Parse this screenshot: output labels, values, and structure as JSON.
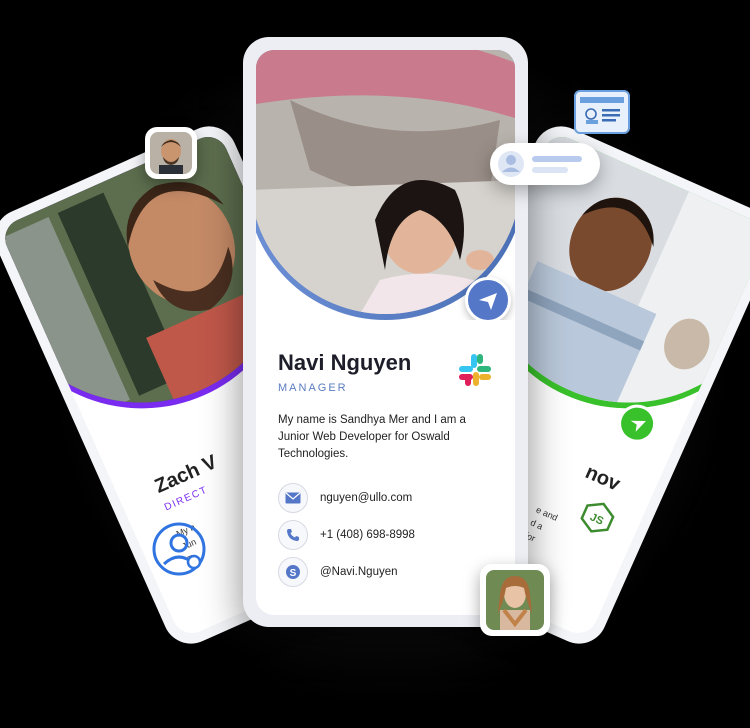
{
  "main_card": {
    "name": "Navi Nguyen",
    "role": "MANAGER",
    "bio": "My name is Sandhya Mer and I am a Junior Web Developer for Oswald Technologies.",
    "contacts": [
      {
        "type": "email",
        "icon": "envelope-icon",
        "value": "nguyen@ullo.com"
      },
      {
        "type": "phone",
        "icon": "phone-icon",
        "value": "+1 (408) 698-8998"
      },
      {
        "type": "skype",
        "icon": "skype-icon",
        "value": "@Navi.Nguyen"
      }
    ],
    "logo": "slack-logo",
    "accent": "#5577c8"
  },
  "left_card": {
    "name": "Zach V",
    "role": "DIRECT",
    "text_lines": [
      "My n",
      "Jun",
      "Te"
    ],
    "accent": "#7a2bf0"
  },
  "right_card": {
    "name": "nov",
    "text_lines": [
      "e and",
      "d a",
      "for"
    ],
    "logo": "nodejs-logo",
    "accent": "#39c12b"
  },
  "decorations": {
    "user_icon_color": "#2f74e0",
    "id_card_icon": "id-card-icon",
    "profile_chip_icon": "profile-chip-icon"
  }
}
